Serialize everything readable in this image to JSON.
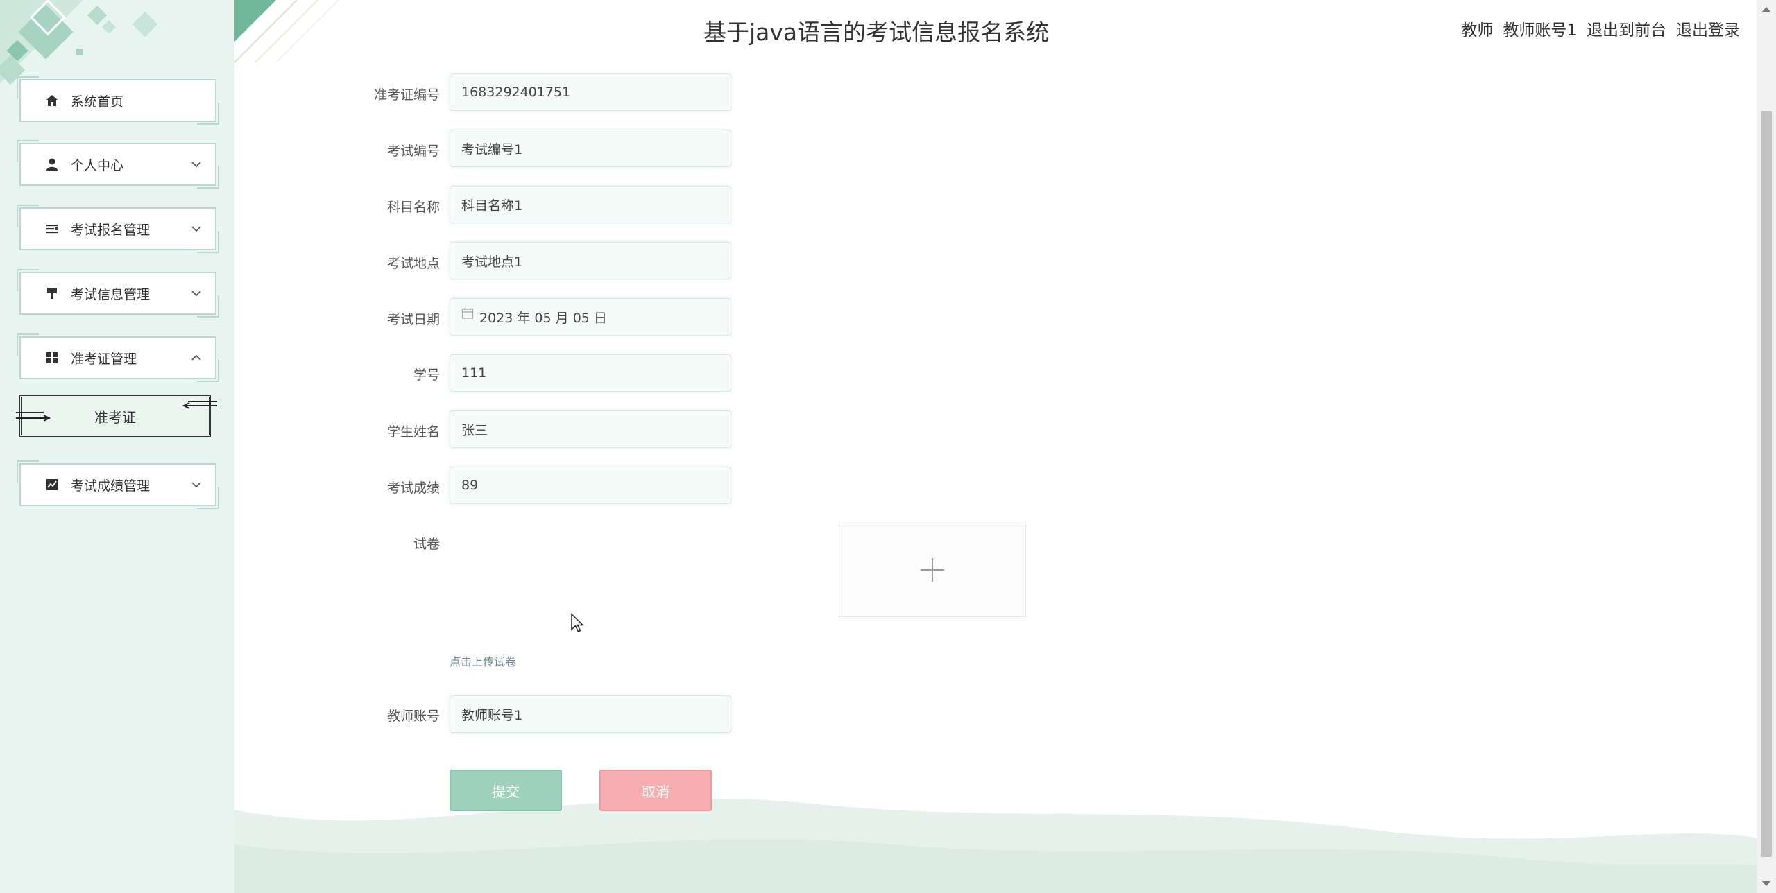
{
  "header": {
    "title": "基于java语言的考试信息报名系统",
    "user_role": "教师",
    "username": "教师账号1",
    "to_front": "退出到前台",
    "logout": "退出登录"
  },
  "sidebar": {
    "items": [
      {
        "label": "系统首页",
        "icon": "home-icon"
      },
      {
        "label": "个人中心",
        "icon": "user-icon"
      },
      {
        "label": "考试报名管理",
        "icon": "list-icon"
      },
      {
        "label": "考试信息管理",
        "icon": "brush-icon"
      },
      {
        "label": "准考证管理",
        "icon": "grid-icon"
      },
      {
        "label": "考试成绩管理",
        "icon": "chart-icon"
      }
    ],
    "sub_items": [
      {
        "label": "准考证"
      }
    ]
  },
  "form": {
    "fields": [
      {
        "label": "准考证编号",
        "value": "1683292401751"
      },
      {
        "label": "考试编号",
        "value": "考试编号1"
      },
      {
        "label": "科目名称",
        "value": "科目名称1"
      },
      {
        "label": "考试地点",
        "value": "考试地点1"
      },
      {
        "label": "考试日期",
        "value": "2023 年 05 月 05 日"
      },
      {
        "label": "学号",
        "value": "111"
      },
      {
        "label": "学生姓名",
        "value": "张三"
      },
      {
        "label": "考试成绩",
        "value": "89"
      }
    ],
    "paper_label": "试卷",
    "upload_hint": "点击上传试卷",
    "teacher_field": {
      "label": "教师账号",
      "value": "教师账号1"
    },
    "submit_label": "提交",
    "cancel_label": "取消"
  },
  "colors": {
    "sidebar_bg": "#e8f4ef",
    "accent_green": "#9fd2bd",
    "accent_red": "#f6aeb0"
  }
}
